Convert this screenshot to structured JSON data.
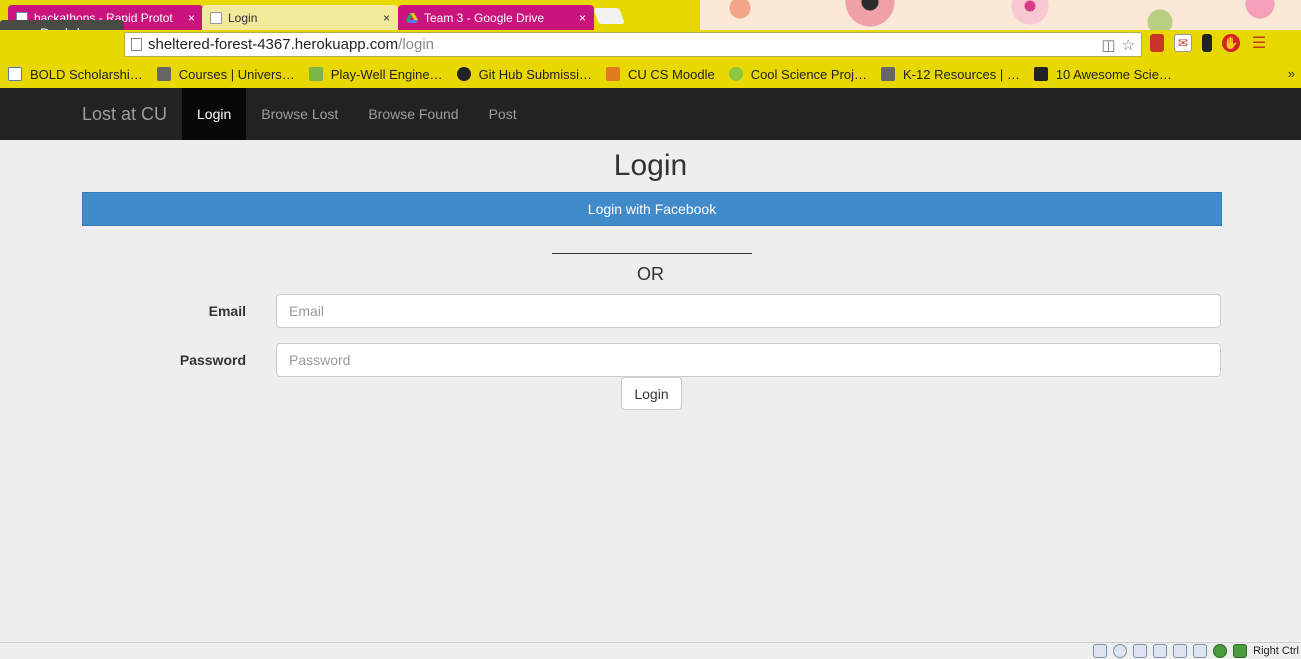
{
  "browser": {
    "tabs": [
      {
        "label": "hackathons - Rapid Protot",
        "active": false
      },
      {
        "label": "Login",
        "active": true
      },
      {
        "label": "Team 3 - Google Drive",
        "active": false
      }
    ],
    "tab_close": "×",
    "tooltip": "Dash home",
    "url_host": "sheltered-forest-4367.herokuapp.com",
    "url_path": "/login",
    "bookmarks": [
      {
        "label": "BOLD Scholarshi…",
        "icon": "page-icon"
      },
      {
        "label": "Courses | Univers…",
        "icon": "site-icon"
      },
      {
        "label": "Play-Well Engine…",
        "icon": "blocks-icon"
      },
      {
        "label": "Git Hub Submissi…",
        "icon": "github-icon"
      },
      {
        "label": "CU CS Moodle",
        "icon": "moodle-icon"
      },
      {
        "label": "Cool Science Proj…",
        "icon": "e-icon"
      },
      {
        "label": "K-12 Resources | …",
        "icon": "site-icon"
      },
      {
        "label": "10 Awesome Scie…",
        "icon": "amazon-icon"
      }
    ],
    "bookmarks_more": "»",
    "colors": {
      "chrome": "#e9d800",
      "tab_inactive": "#c9137d"
    }
  },
  "navbar": {
    "brand": "Lost at CU",
    "links": [
      {
        "label": "Login",
        "active": true
      },
      {
        "label": "Browse Lost",
        "active": false
      },
      {
        "label": "Browse Found",
        "active": false
      },
      {
        "label": "Post",
        "active": false
      }
    ]
  },
  "login": {
    "title": "Login",
    "facebook_button": "Login with Facebook",
    "or_text": "OR",
    "email_label": "Email",
    "email_placeholder": "Email",
    "password_label": "Password",
    "password_placeholder": "Password",
    "submit_label": "Login",
    "colors": {
      "facebook": "#428bca",
      "navbar": "#222222"
    }
  },
  "statusbar": {
    "host_key": "Right Ctrl"
  }
}
